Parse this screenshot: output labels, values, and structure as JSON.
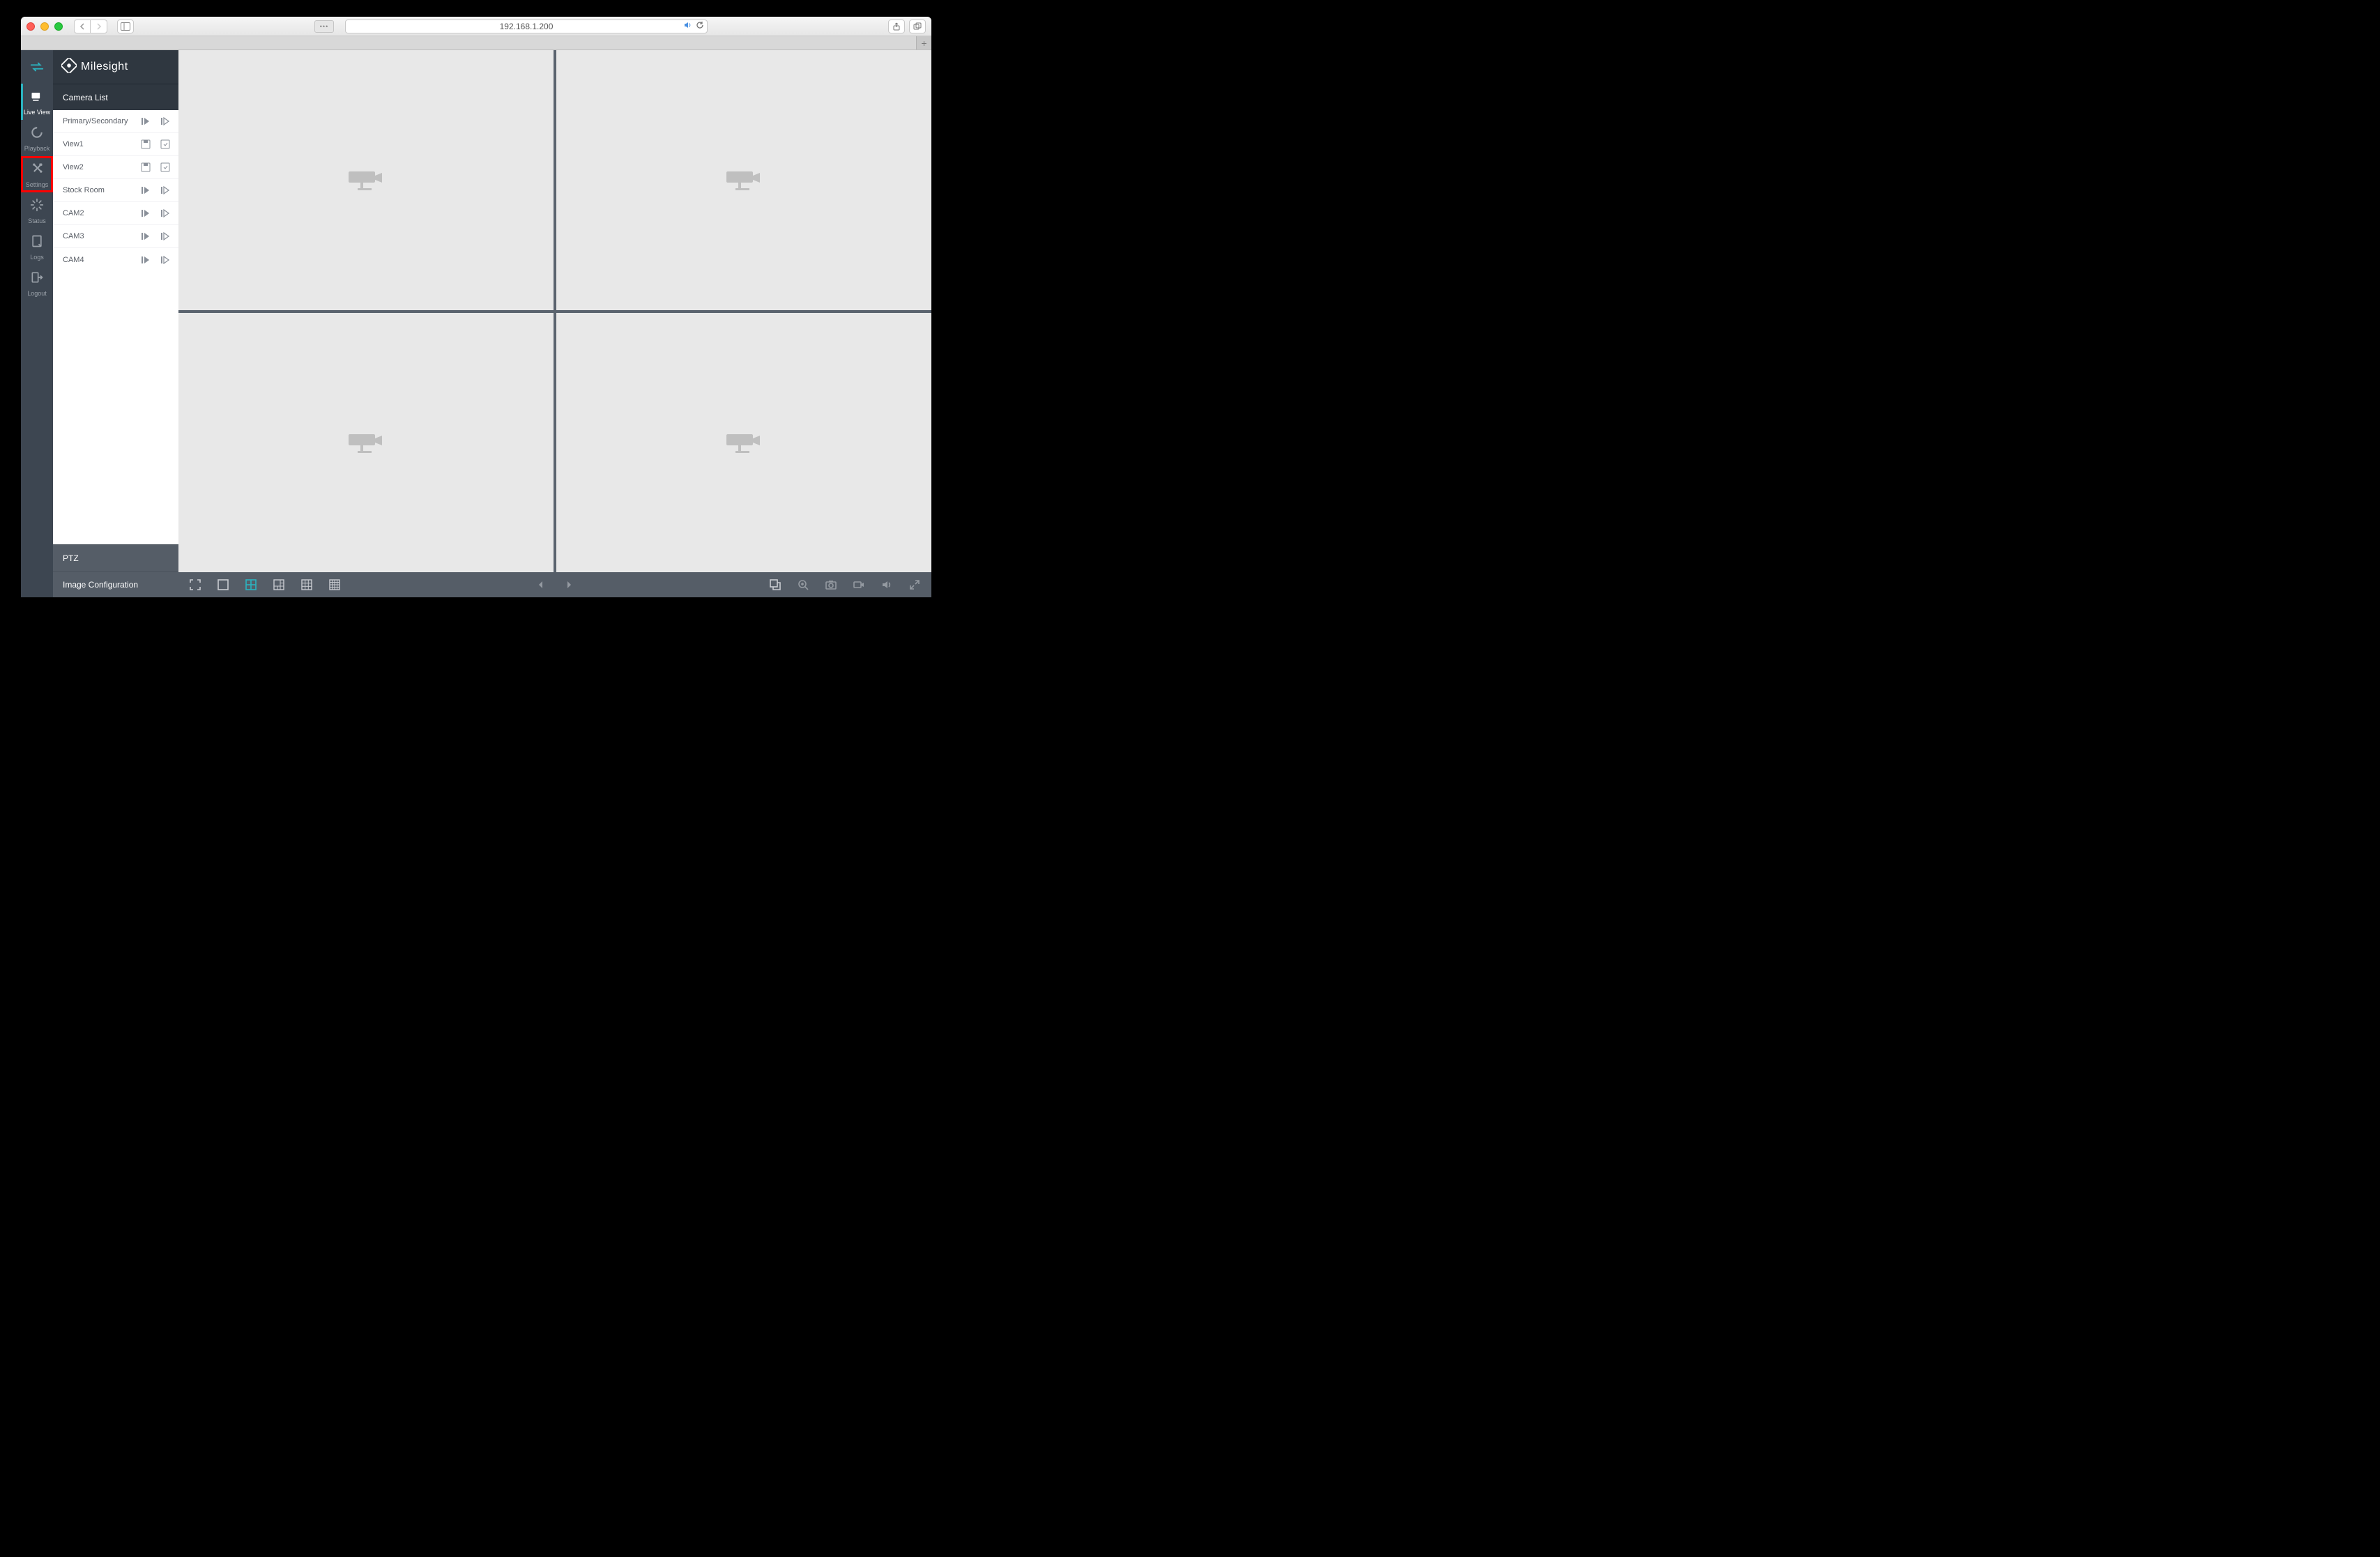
{
  "browser": {
    "url": "192.168.1.200"
  },
  "brand": {
    "name": "Milesight"
  },
  "rail": {
    "items": [
      {
        "label": "Live View",
        "icon": "live"
      },
      {
        "label": "Playback",
        "icon": "playback"
      },
      {
        "label": "Settings",
        "icon": "settings"
      },
      {
        "label": "Status",
        "icon": "status"
      },
      {
        "label": "Logs",
        "icon": "logs"
      },
      {
        "label": "Logout",
        "icon": "logout"
      }
    ]
  },
  "panel": {
    "title": "Camera List",
    "header_row": {
      "label": "Primary/Secondary"
    },
    "rows": [
      {
        "name": "View1",
        "type": "view"
      },
      {
        "name": "View2",
        "type": "view"
      },
      {
        "name": "Stock Room",
        "type": "cam"
      },
      {
        "name": "CAM2",
        "type": "cam"
      },
      {
        "name": "CAM3",
        "type": "cam"
      },
      {
        "name": "CAM4",
        "type": "cam"
      }
    ],
    "sections": [
      {
        "label": "PTZ"
      },
      {
        "label": "Image Configuration"
      }
    ]
  },
  "footbar": {
    "layout_active_index": 2
  }
}
